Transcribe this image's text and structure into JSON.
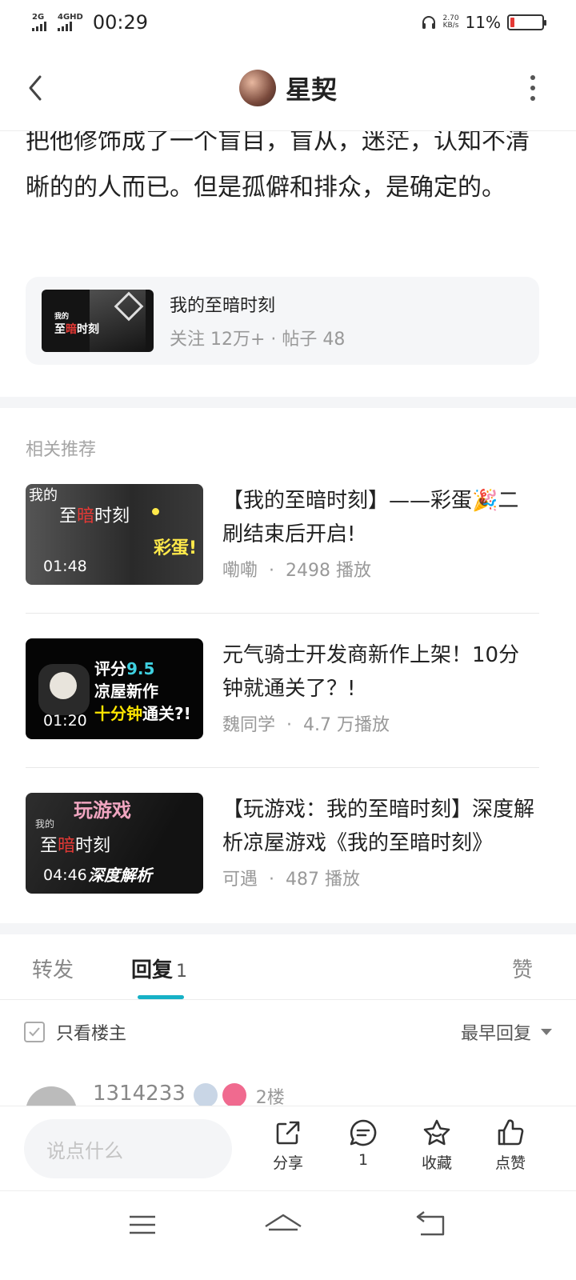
{
  "status_bar": {
    "sig1_label": "2G",
    "sig2_label": "4GHD",
    "time": "00:29",
    "net_speed_value": "2.70",
    "net_speed_unit": "KB/s",
    "battery_pct": "11%",
    "battery_level": 0.11,
    "battery_color": "#e53935"
  },
  "header": {
    "title": "星契"
  },
  "post": {
    "text": "把他修饰成了一个盲目，盲从，迷茫，认知不清晰的的人而已。但是孤僻和排众，是确定的。"
  },
  "forum": {
    "name": "我的至暗时刻",
    "meta": "关注 12万+ · 帖子 48",
    "thumb_text_pre": "我的",
    "thumb_text_a": "至",
    "thumb_text_b": "暗",
    "thumb_text_c": "时刻"
  },
  "recommend": {
    "title": "相关推荐",
    "items": [
      {
        "title": "【我的至暗时刻】——彩蛋🎉二刷结束后开启!",
        "author": "嘞嘞",
        "plays": "2498 播放",
        "duration": "01:48",
        "thumb": {
          "pre": "我的",
          "a": "至",
          "b": "暗",
          "c": "时刻",
          "extra": "彩蛋!"
        }
      },
      {
        "title": "元气骑士开发商新作上架！10分钟就通关了？!",
        "author": "魏同学",
        "plays": "4.7 万播放",
        "duration": "01:20",
        "thumb": {
          "line1a": "评分",
          "line1b": "9.5",
          "line2": "凉屋新作",
          "line3a": "十分钟",
          "line3b": "通关?!"
        }
      },
      {
        "title": "【玩游戏：我的至暗时刻】深度解析凉屋游戏《我的至暗时刻》",
        "author": "可遇",
        "plays": "487 播放",
        "duration": "04:46",
        "thumb": {
          "top": "玩游戏",
          "pre": "我的",
          "a": "至",
          "b": "暗",
          "c": "时刻",
          "extra": "深度解析"
        }
      }
    ]
  },
  "tabs": {
    "forward": "转发",
    "reply": "回复",
    "reply_count": "1",
    "like": "赞"
  },
  "filter": {
    "only_op": "只看楼主",
    "sort": "最早回复"
  },
  "reply": {
    "user": "1314233",
    "floor": "2楼"
  },
  "actions": {
    "input_placeholder": "说点什么",
    "share": "分享",
    "comment_count": "1",
    "collect": "收藏",
    "like": "点赞"
  },
  "colors": {
    "accent": "#16b1c6"
  }
}
